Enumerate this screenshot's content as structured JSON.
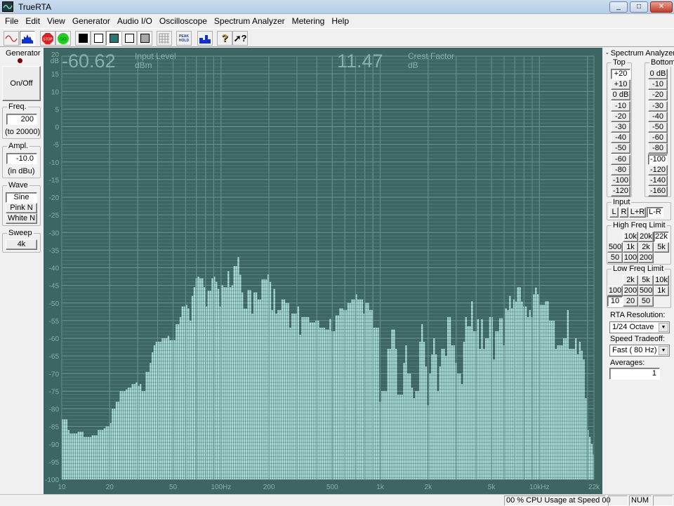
{
  "window": {
    "title": "TrueRTA",
    "controls": [
      "_",
      "□",
      "✕"
    ]
  },
  "menu": [
    "File",
    "Edit",
    "View",
    "Generator",
    "Audio I/O",
    "Oscilloscope",
    "Spectrum Analyzer",
    "Metering",
    "Help"
  ],
  "toolbar": {
    "items": [
      {
        "name": "oscilloscope-view-button",
        "icon": "sine-wave-icon"
      },
      {
        "name": "spectrum-view-button",
        "icon": "spectrum-icon",
        "pressed": true
      },
      {
        "name": "stop-button",
        "icon": "stop-sign-icon",
        "label": "STOP"
      },
      {
        "name": "go-button",
        "icon": "go-icon",
        "label": "GO"
      },
      {
        "name": "color-black-button",
        "color": "#000000"
      },
      {
        "name": "color-white-button",
        "color": "#ffffff"
      },
      {
        "name": "color-teal-button",
        "color": "#1f7b78",
        "pressed": true
      },
      {
        "name": "color-light-button",
        "color": "#f4f4f4"
      },
      {
        "name": "color-gray-button",
        "color": "#a8a8a8"
      },
      {
        "name": "grid-button",
        "icon": "grid-icon"
      },
      {
        "name": "peak-hold-button",
        "icon": "peak-hold-icon",
        "label": "PEAK HOLD"
      },
      {
        "name": "bar-graph-button",
        "icon": "bar-graph-icon"
      },
      {
        "name": "help-button",
        "icon": "help-icon",
        "label": "?"
      },
      {
        "name": "whats-this-button",
        "icon": "whats-this-icon",
        "label": "?"
      }
    ]
  },
  "generator": {
    "title": "Generator",
    "led_color": "#7a0000",
    "onoff": "On/Off",
    "freq": {
      "label": "Freq.",
      "value": "200",
      "hint": "(to 20000)"
    },
    "ampl": {
      "label": "Ampl.",
      "value": "-10.0",
      "hint": "(in dBu)"
    },
    "wave": {
      "label": "Wave",
      "options": [
        "Sine",
        "Pink N",
        "White N"
      ],
      "selected": "Sine"
    },
    "sweep": {
      "label": "Sweep",
      "button": "4k"
    }
  },
  "readouts": {
    "input_level": {
      "value": "-60.62",
      "label": "Input Level",
      "unit": "dBm"
    },
    "crest_factor": {
      "value": "11.47",
      "label": "Crest Factor",
      "unit": "dB"
    }
  },
  "analyzer": {
    "title": "- Spectrum Analyzer -",
    "top": {
      "label": "Top",
      "options": [
        "+20",
        "+10",
        "0 dB",
        "-10",
        "-20",
        "-30",
        "-40",
        "-50",
        "-60",
        "-80",
        "-100",
        "-120"
      ],
      "selected": "+20"
    },
    "bottom": {
      "label": "Bottom",
      "options": [
        "0 dB",
        "-10",
        "-20",
        "-30",
        "-40",
        "-50",
        "-60",
        "-80",
        "-100",
        "-120",
        "-140",
        "-160"
      ],
      "selected": "-100"
    },
    "input": {
      "label": "Input",
      "options": [
        "L",
        "R",
        "L+R",
        "L-R"
      ],
      "selected": "L-R"
    },
    "high_freq": {
      "label": "High Freq Limit",
      "rows": [
        [
          "",
          "10k",
          "20k",
          "22k"
        ],
        [
          "500",
          "1k",
          "2k",
          "5k"
        ],
        [
          "50",
          "100",
          "200",
          ""
        ]
      ],
      "selected": "22k"
    },
    "low_freq": {
      "label": "Low Freq Limit",
      "rows": [
        [
          "",
          "2k",
          "5k",
          "10k"
        ],
        [
          "100",
          "200",
          "500",
          "1k"
        ],
        [
          "10",
          "20",
          "50",
          ""
        ]
      ],
      "selected": "10"
    },
    "rta_resolution": {
      "label": "RTA Resolution:",
      "value": "1/24 Octave"
    },
    "speed_tradeoff": {
      "label": "Speed Tradeoff:",
      "value": "Fast ( 80 Hz)"
    },
    "averages": {
      "label": "Averages:",
      "value": "1"
    }
  },
  "status": {
    "cpu": "00 % CPU Usage at Speed 00",
    "num": "NUM"
  },
  "colors": {
    "chart_bg": "#3d6662",
    "bar": "#a9dbd3",
    "grid": "#5f8c87",
    "readout": "#86b0aa"
  },
  "chart_data": {
    "type": "bar",
    "xscale": "log",
    "xlim": [
      10,
      22000
    ],
    "ylim": [
      -100,
      20
    ],
    "yunit": "dB",
    "grid": true,
    "resolution": "1/24 Octave",
    "start_freq": 10,
    "yticks": [
      20,
      15,
      10,
      5,
      0,
      -5,
      -10,
      -15,
      -20,
      -25,
      -30,
      -35,
      -40,
      -45,
      -50,
      -55,
      -60,
      -65,
      -70,
      -75,
      -80,
      -85,
      -90,
      -95,
      -100
    ],
    "ytick_unit": "dB",
    "xticks": [
      {
        "f": 10,
        "label": "10"
      },
      {
        "f": 20,
        "label": "20"
      },
      {
        "f": 50,
        "label": "50"
      },
      {
        "f": 100,
        "label": "100Hz"
      },
      {
        "f": 200,
        "label": "200"
      },
      {
        "f": 500,
        "label": "500"
      },
      {
        "f": 1000,
        "label": "1k"
      },
      {
        "f": 2000,
        "label": "2k"
      },
      {
        "f": 5000,
        "label": "5k"
      },
      {
        "f": 10000,
        "label": "10kHz"
      },
      {
        "f": 22000,
        "label": "22k"
      }
    ],
    "values": [
      -83,
      -83,
      -83,
      -86,
      -87,
      -87,
      -87,
      -87,
      -86.5,
      -86.5,
      -86.5,
      -88,
      -88,
      -88,
      -88,
      -87.5,
      -87.5,
      -87.5,
      -86,
      -86,
      -86,
      -85.5,
      -85,
      -85,
      -84,
      -80,
      -80,
      -78,
      -78,
      -75,
      -75,
      -75,
      -74.5,
      -74,
      -74,
      -73,
      -73,
      -72.5,
      -73.5,
      -73,
      -75,
      -75,
      -69.5,
      -69.5,
      -67,
      -64,
      -62,
      -61,
      -61,
      -61,
      -60,
      -60,
      -60,
      -59.3,
      -60.5,
      -60.5,
      -60.5,
      -56,
      -56,
      -54,
      -51,
      -51,
      -50.5,
      -51.5,
      -55,
      -48,
      -45.5,
      -43,
      -42.5,
      -43,
      -43,
      -45.5,
      -51,
      -46.5,
      -46.5,
      -43,
      -42.5,
      -44,
      -46,
      -51,
      -45,
      -45.5,
      -45.5,
      -41,
      -45.5,
      -45,
      -39.5,
      -39.5,
      -37,
      -42,
      -47,
      -51.6,
      -51.6,
      -46.3,
      -46.3,
      -53,
      -47,
      -47,
      -49,
      -49,
      -43.3,
      -43.3,
      -43.3,
      -41.9,
      -44,
      -52,
      -46,
      -53,
      -52,
      -52,
      -49,
      -49,
      -50,
      -50,
      -57,
      -53,
      -53,
      -53,
      -51,
      -59,
      -54,
      -54,
      -54,
      -54,
      -55.5,
      -55.5,
      -55.5,
      -55,
      -55,
      -57,
      -57,
      -57,
      -57.5,
      -57.5,
      -54.5,
      -58,
      -58,
      -53.5,
      -53.5,
      -51.5,
      -51.5,
      -52,
      -52,
      -50,
      -50,
      -49,
      -49,
      -47.5,
      -49,
      -49,
      -49,
      -53,
      -50,
      -50,
      -52,
      -52,
      -57,
      -57,
      -57,
      -78,
      -75,
      -75,
      -75,
      -63,
      -63,
      -57.5,
      -57.5,
      -63,
      -76,
      -76,
      -76,
      -67,
      -62,
      -70,
      -70,
      -74,
      -77,
      -75,
      -75,
      -61,
      -56,
      -61,
      -68,
      -79,
      -70,
      -64.6,
      -60,
      -64.6,
      -75,
      -68,
      -63,
      -63,
      -65,
      -54,
      -54,
      -62,
      -62,
      -67,
      -70,
      -70,
      -73,
      -61,
      -54,
      -56.6,
      -56.6,
      -49.5,
      -58,
      -58,
      -54.6,
      -63,
      -54.6,
      -63,
      -60,
      -60,
      -54,
      -54,
      -66,
      -58,
      -58,
      -54.3,
      -54.3,
      -62,
      -51.5,
      -52,
      -48,
      -51.5,
      -49,
      -49.6,
      -45.5,
      -45.5,
      -49.6,
      -51,
      -51,
      -54,
      -52,
      -54,
      -47.5,
      -45.6,
      -47.5,
      -50.5,
      -50.5,
      -50.5,
      -49.5,
      -49.5,
      -55,
      -55,
      -55,
      -63,
      -62,
      -62,
      -62,
      -60,
      -60,
      -52,
      -63,
      -63,
      -63,
      -60,
      -64.5,
      -61,
      -63.5,
      -66,
      -77,
      -86,
      -88,
      -90,
      -93
    ]
  }
}
